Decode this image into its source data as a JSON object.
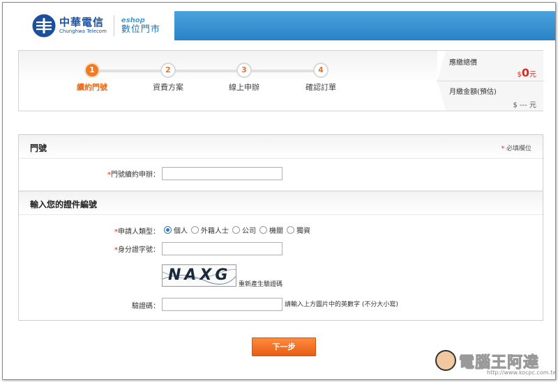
{
  "header": {
    "brand_cn": "中華電信",
    "brand_en": "Chunghwa Telecom",
    "shop_en": "eshop",
    "shop_cn": "數位門市",
    "brand_color": "#1c4f9c",
    "bar_color": "#3a93d2"
  },
  "steps": [
    {
      "num": "1",
      "label": "續約門號",
      "active": true
    },
    {
      "num": "2",
      "label": "資費方案",
      "active": false
    },
    {
      "num": "3",
      "label": "線上申辦",
      "active": false
    },
    {
      "num": "4",
      "label": "確認訂單",
      "active": false
    }
  ],
  "price": {
    "total_label": "應繳總價",
    "total_currency": "$",
    "total_value": "0",
    "total_unit": "元",
    "monthly_label": "月繳金額(預估)",
    "monthly_value": "$ --- 元"
  },
  "form": {
    "section1_title": "門號",
    "required_note": "必填欄位",
    "phone_label": "門號續約申辦：",
    "phone_value": "",
    "section2_title": "輸入您的證件編號",
    "applicant_type_label": "申請人類型：",
    "applicant_types": [
      "個人",
      "外籍人士",
      "公司",
      "機關",
      "獨資"
    ],
    "applicant_selected": "個人",
    "id_label": "身分證字號：",
    "id_value": "",
    "captcha_text": "NAXG",
    "refresh_label": "重新產生驗證碼",
    "captcha_label": "驗證碼：",
    "captcha_value": "",
    "captcha_hint": "請輸入上方圖片中的英數字 (不分大小寫)",
    "required_mark": "*"
  },
  "actions": {
    "next_label": "下一步",
    "accent_color": "#ef7b27"
  },
  "watermark": {
    "text": "電腦王阿達",
    "url": "http://www.kocpc.com.tw"
  }
}
